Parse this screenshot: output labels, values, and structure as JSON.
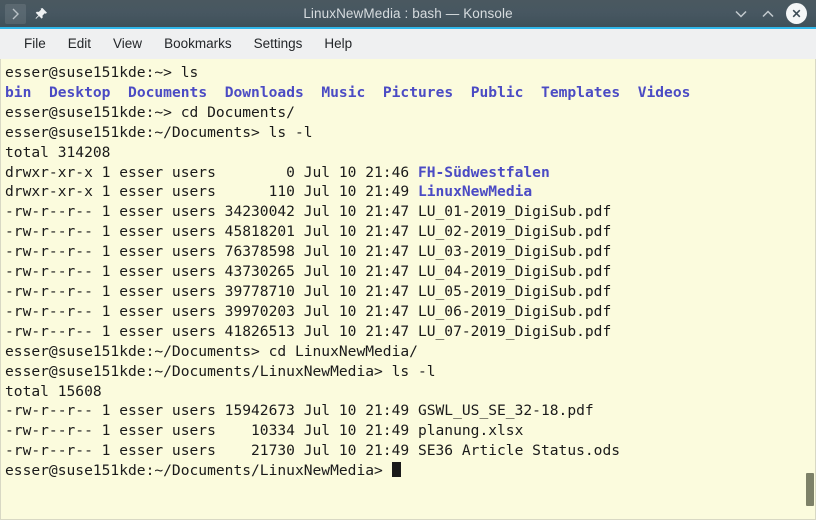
{
  "window": {
    "title": "LinuxNewMedia : bash — Konsole",
    "accent_color": "#30b7ea",
    "titlebar_color": "#47565f",
    "left_buttons": [
      {
        "name": "expand-chevron-icon",
        "glyph": "›"
      },
      {
        "name": "pin-icon",
        "glyph": "📌"
      }
    ],
    "controls": {
      "minimize": "∨",
      "maximize": "∧",
      "close": "✕"
    }
  },
  "menubar": {
    "items": [
      {
        "label": "File"
      },
      {
        "label": "Edit"
      },
      {
        "label": "View"
      },
      {
        "label": "Bookmarks"
      },
      {
        "label": "Settings"
      },
      {
        "label": "Help"
      }
    ]
  },
  "terminal": {
    "background_color": "#fbfbdd",
    "foreground_color": "#1a1a1a",
    "directory_color": "#4b4bc4",
    "scrollbar_thumb_color": "#7d8168",
    "lines": [
      {
        "id": "l1",
        "text": "esser@suse151kde:~> ls"
      },
      {
        "id": "l2",
        "type": "dirlist",
        "names": [
          "bin",
          "Desktop",
          "Documents",
          "Downloads",
          "Music",
          "Pictures",
          "Public",
          "Templates",
          "Videos"
        ]
      },
      {
        "id": "l3",
        "text": "esser@suse151kde:~> cd Documents/"
      },
      {
        "id": "l4",
        "text": "esser@suse151kde:~/Documents> ls -l"
      },
      {
        "id": "l5",
        "text": "total 314208"
      },
      {
        "id": "l6",
        "prefix": "drwxr-xr-x 1 esser users        0 Jul 10 21:46 ",
        "dir": "FH-Südwestfalen"
      },
      {
        "id": "l7",
        "prefix": "drwxr-xr-x 1 esser users      110 Jul 10 21:49 ",
        "dir": "LinuxNewMedia"
      },
      {
        "id": "l8",
        "text": "-rw-r--r-- 1 esser users 34230042 Jul 10 21:47 LU_01-2019_DigiSub.pdf"
      },
      {
        "id": "l9",
        "text": "-rw-r--r-- 1 esser users 45818201 Jul 10 21:47 LU_02-2019_DigiSub.pdf"
      },
      {
        "id": "l10",
        "text": "-rw-r--r-- 1 esser users 76378598 Jul 10 21:47 LU_03-2019_DigiSub.pdf"
      },
      {
        "id": "l11",
        "text": "-rw-r--r-- 1 esser users 43730265 Jul 10 21:47 LU_04-2019_DigiSub.pdf"
      },
      {
        "id": "l12",
        "text": "-rw-r--r-- 1 esser users 39778710 Jul 10 21:47 LU_05-2019_DigiSub.pdf"
      },
      {
        "id": "l13",
        "text": "-rw-r--r-- 1 esser users 39970203 Jul 10 21:47 LU_06-2019_DigiSub.pdf"
      },
      {
        "id": "l14",
        "text": "-rw-r--r-- 1 esser users 41826513 Jul 10 21:47 LU_07-2019_DigiSub.pdf"
      },
      {
        "id": "l15",
        "text": "esser@suse151kde:~/Documents> cd LinuxNewMedia/"
      },
      {
        "id": "l16",
        "text": "esser@suse151kde:~/Documents/LinuxNewMedia> ls -l"
      },
      {
        "id": "l17",
        "text": "total 15608"
      },
      {
        "id": "l18",
        "text": "-rw-r--r-- 1 esser users 15942673 Jul 10 21:49 GSWL_US_SE_32-18.pdf"
      },
      {
        "id": "l19",
        "text": "-rw-r--r-- 1 esser users    10334 Jul 10 21:49 planung.xlsx"
      },
      {
        "id": "l20",
        "text": "-rw-r--r-- 1 esser users    21730 Jul 10 21:49 SE36 Article Status.ods"
      }
    ],
    "prompt": "esser@suse151kde:~/Documents/LinuxNewMedia> "
  }
}
